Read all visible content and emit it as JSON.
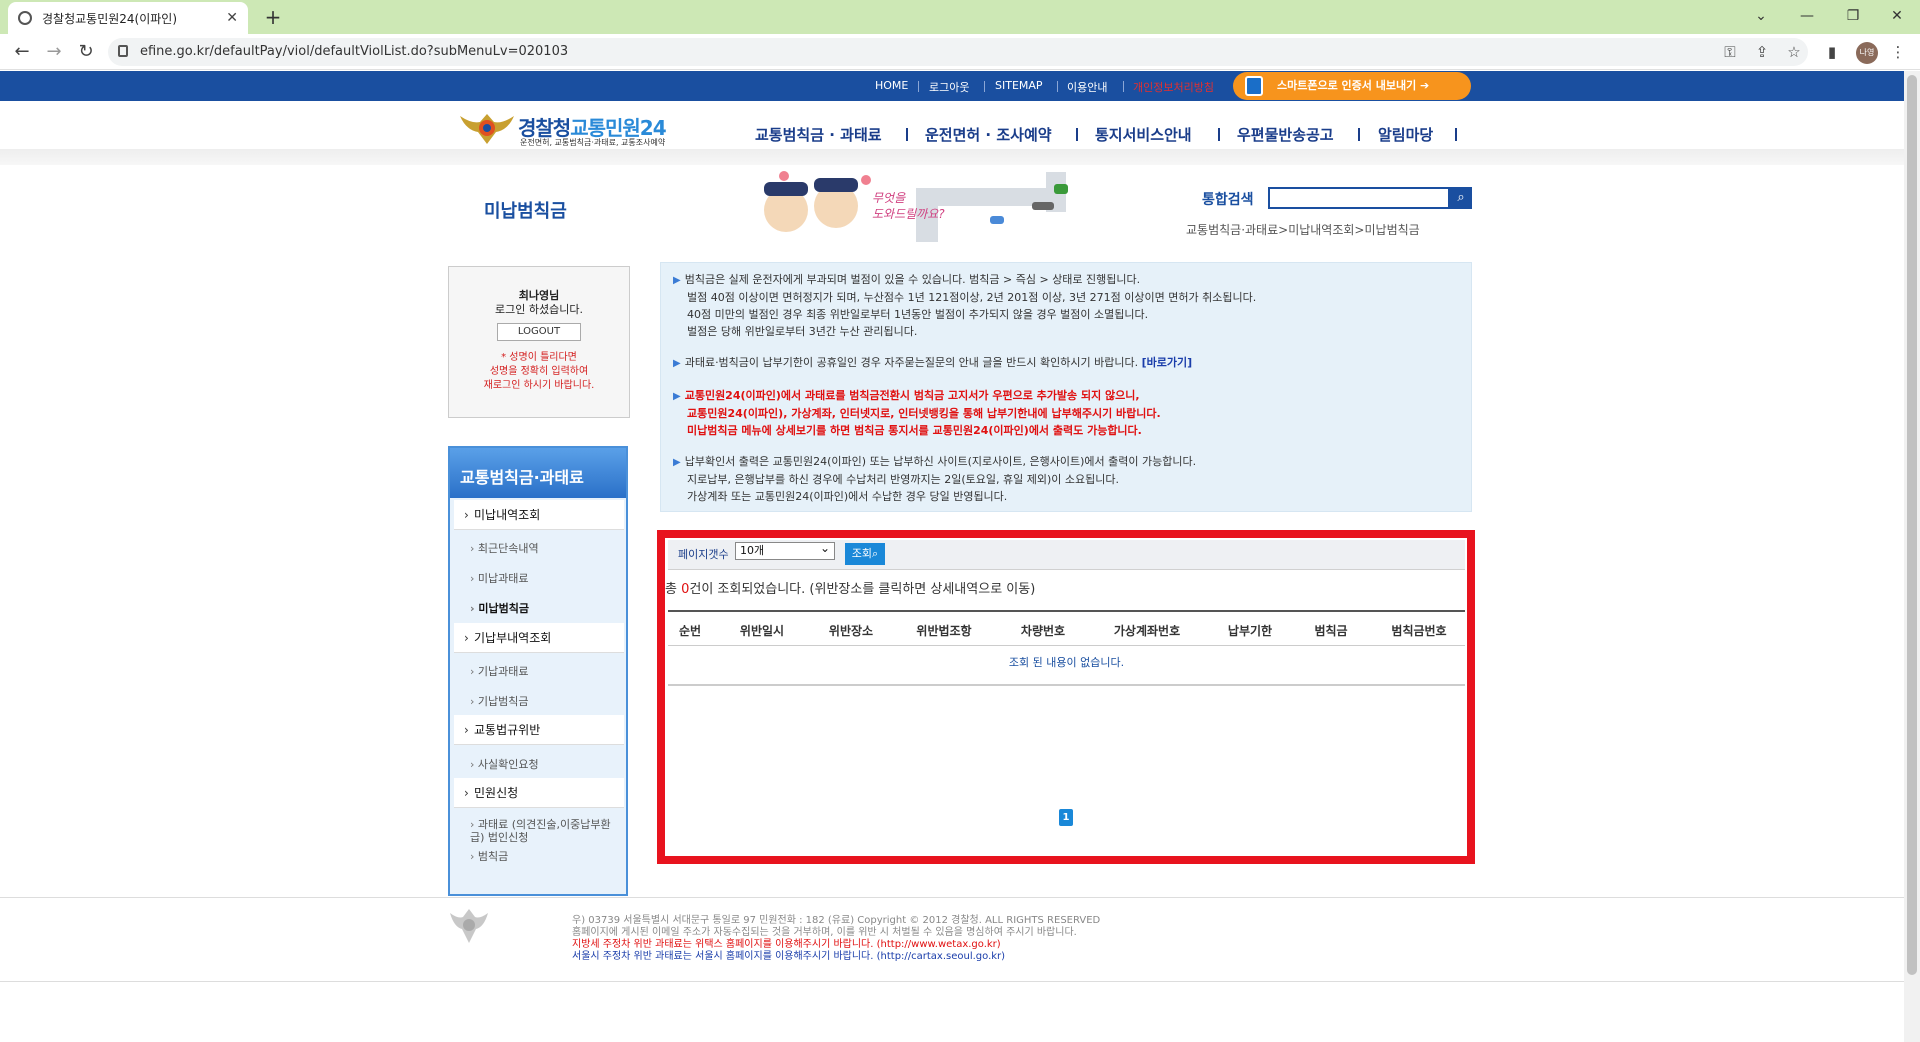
{
  "browser": {
    "tab_title": "경찰청교통민원24(이파인)",
    "url": "efine.go.kr/defaultPay/viol/defaultViolList.do?subMenuLv=020103",
    "profile_label": "나영"
  },
  "topbar": {
    "links": [
      "HOME",
      "로그아웃",
      "SITEMAP",
      "이용안내"
    ],
    "red_link": "개인정보처리방침",
    "smart_button": "스마트폰으로 인증서 내보내기 ➔"
  },
  "header": {
    "logo_main": "경찰청",
    "logo_accent": "교통민원24",
    "logo_sub": "운전면허, 교통범칙금·과태료, 교통조사예약",
    "gnb": [
      "교통범칙금 · 과태료",
      "운전면허 · 조사예약",
      "통지서비스안내",
      "우편물반송공고",
      "알림마당"
    ]
  },
  "content_header": {
    "page_title": "미납범칙금",
    "search_label": "통합검색",
    "breadcrumb": "교통범칙금·과태료>미납내역조회>미납범칙금"
  },
  "login": {
    "name_line": "최나영님",
    "greeting": "로그인 하셨습니다.",
    "logout_button": "LOGOUT",
    "warning_1": "* 성명이 틀리다면",
    "warning_2": "성명을 정확히 입력하여",
    "warning_3": "재로그인 하시기 바랍니다."
  },
  "sidebar": {
    "heading": "교통범칙금·과태료",
    "items": [
      {
        "label": "미납내역조회"
      },
      {
        "label": "최근단속내역"
      },
      {
        "label": "미납과태료"
      },
      {
        "label": "미납범칙금"
      },
      {
        "label": "기납부내역조회"
      },
      {
        "label": "기납과태료"
      },
      {
        "label": "기납범칙금"
      },
      {
        "label": "교통법규위반"
      },
      {
        "label": "사실확인요청"
      },
      {
        "label": "민원신청"
      },
      {
        "label": "과태료 (의견진술,이중납부환급) 법인신청"
      },
      {
        "label": "범칙금"
      }
    ]
  },
  "info": {
    "p1_l1": "범칙금은 실제 운전자에게 부과되며 벌점이 있을 수 있습니다. 범칙금 > 즉심 > 상태로 진행됩니다.",
    "p1_l2": "벌점 40점 이상이면 면허정지가 되며, 누산점수 1년 121점이상, 2년 201점 이상, 3년 271점 이상이면 면허가 취소됩니다.",
    "p1_l3": "40점 미만의 벌점인 경우 최종 위반일로부터 1년동안 벌점이 추가되지 않을 경우 벌점이 소멸됩니다.",
    "p1_l4": "벌점은 당해 위반일로부터 3년간 누산 관리됩니다.",
    "p2": "과태료·범칙금이 납부기한이 공휴일인 경우 자주묻는질문의 안내 글을 반드시 확인하시기 바랍니다.",
    "p2_link": "[바로가기]",
    "p3_l1": "교통민원24(이파인)에서 과태료를 범칙금전환시 범칙금 고지서가 우편으로 추가발송 되지 않으니,",
    "p3_l2": "교통민원24(이파인), 가상계좌, 인터넷지로, 인터넷뱅킹을 통해 납부기한내에 납부해주시기 바랍니다.",
    "p3_l3": "미납범칙금 메뉴에 상세보기를 하면 범칙금 통지서를 교통민원24(이파인)에서 출력도 가능합니다.",
    "p4_l1": "납부확인서 출력은 교통민원24(이파인) 또는 납부하신 사이트(지로사이트, 은행사이트)에서 출력이 가능합니다.",
    "p4_l2": "지로납부, 은행납부를 하신 경우에 수납처리 반영까지는 2일(토요일, 휴일 제외)이 소요됩니다.",
    "p4_l3": "가상계좌 또는 교통민원24(이파인)에서 수납한 경우 당일 반영됩니다."
  },
  "results": {
    "filter_label": "페이지갯수",
    "filter_value": "10개",
    "filter_button": "조회",
    "count_prefix": "총 ",
    "count_value": "0",
    "count_suffix": "건이 조회되었습니다. (위반장소를 클릭하면 상세내역으로 이동)",
    "columns": [
      "순번",
      "위반일시",
      "위반장소",
      "위반법조항",
      "차량번호",
      "가상계좌번호",
      "납부기한",
      "범칙금",
      "범칙금번호"
    ],
    "empty_message": "조회 된 내용이 없습니다.",
    "page": "1"
  },
  "footer": {
    "address": "우) 03739 서울특별시 서대문구 통일로 97   민원전화 : 182 (유료)        Copyright © 2012 경찰청. ALL RIGHTS RESERVED",
    "notice": "홈페이지에 게시된 이메일 주소가 자동수집되는 것을 거부하며, 이를 위반 시 처벌될 수 있음을 명심하여 주시기 바랍니다.",
    "local_tax": "지방세 주정차 위반 과태료는 위택스 홈페이지를 이용해주시기 바랍니다. (http://www.wetax.go.kr)",
    "seoul_tax": "서울시 주정차 위반 과태료는 서울시 홈페이지를 이용해주시기 바랍니다. (http://cartax.seoul.go.kr)"
  }
}
